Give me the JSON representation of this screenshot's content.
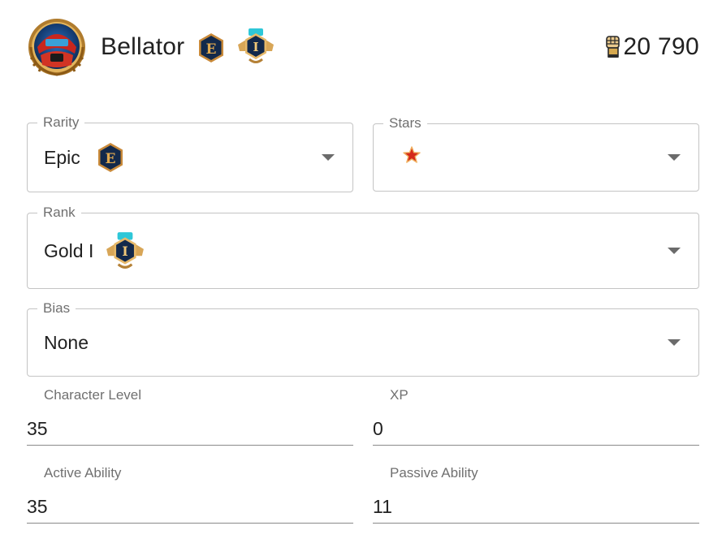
{
  "header": {
    "character_name": "Bellator",
    "avatar_icon": "character-portrait-icon",
    "rarity_icon": "epic-rarity-icon",
    "rank_icon": "gold-rank-icon",
    "power_icon": "fist-power-icon",
    "power_value": "20 790"
  },
  "form": {
    "rarity": {
      "label": "Rarity",
      "value": "Epic",
      "icon": "epic-rarity-icon"
    },
    "stars": {
      "label": "Stars",
      "value_icon": "red-star-icon",
      "count": 1
    },
    "rank": {
      "label": "Rank",
      "value": "Gold I",
      "icon": "gold-rank-icon"
    },
    "bias": {
      "label": "Bias",
      "value": "None"
    },
    "character_level": {
      "label": "Character Level",
      "value": "35"
    },
    "xp": {
      "label": "XP",
      "value": "0"
    },
    "active_ability": {
      "label": "Active Ability",
      "value": "35"
    },
    "passive_ability": {
      "label": "Passive Ability",
      "value": "11"
    }
  },
  "colors": {
    "outline": "#c4c4c4",
    "label": "#707070",
    "text": "#212121",
    "epic_hex_fill": "#13294b",
    "epic_hex_border": "#c98a3a",
    "gold": "#d8a657",
    "star_red": "#d42a1a"
  }
}
